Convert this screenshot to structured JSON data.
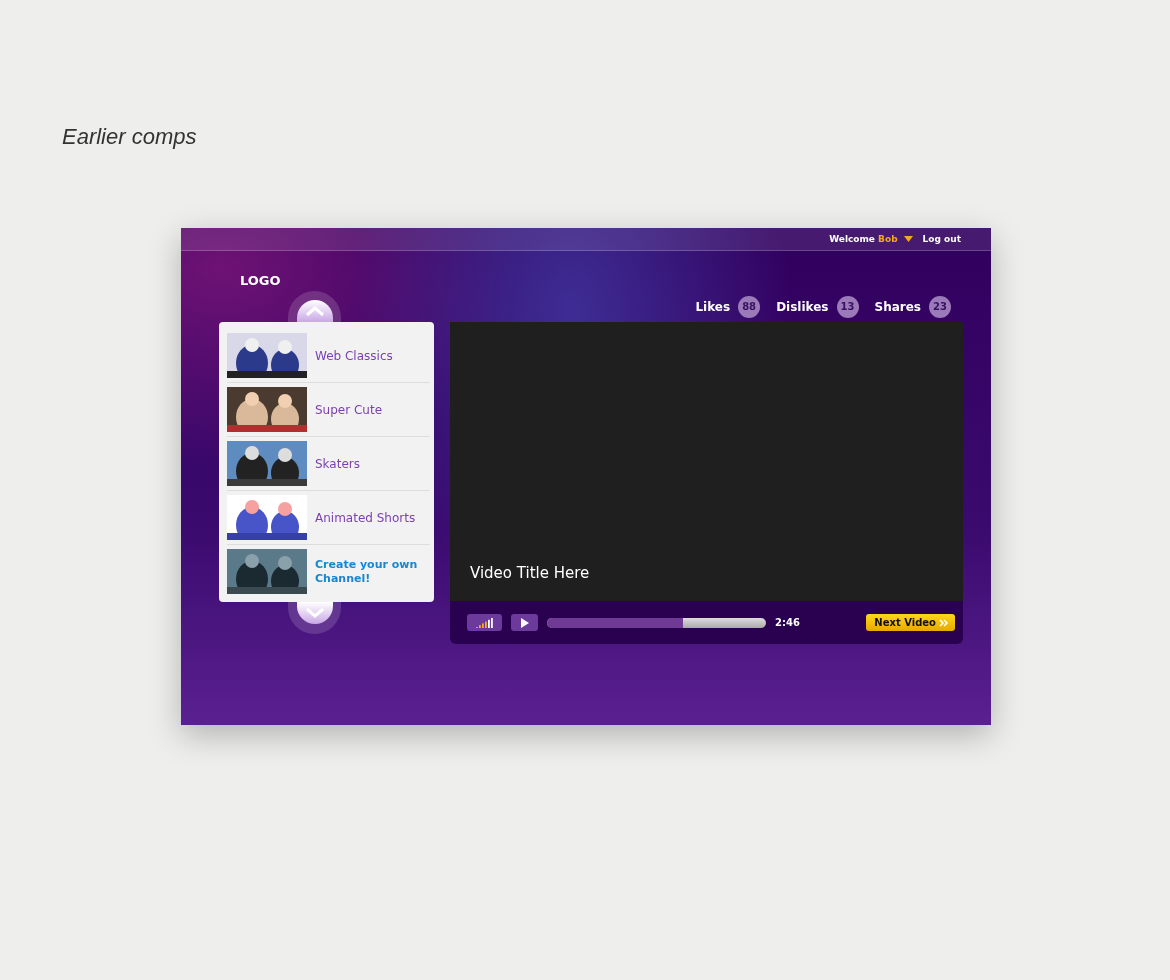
{
  "heading": "Earlier comps",
  "top_bar": {
    "welcome": "Welcome",
    "user": "Bob",
    "logout": "Log out"
  },
  "logo": "LOGO",
  "stats": [
    {
      "label": "Likes",
      "count": "88"
    },
    {
      "label": "Dislikes",
      "count": "13"
    },
    {
      "label": "Shares",
      "count": "23"
    }
  ],
  "channels": [
    {
      "kind": "category",
      "label": "Web Classics"
    },
    {
      "kind": "category",
      "label": "Super Cute"
    },
    {
      "kind": "category",
      "label": "Skaters"
    },
    {
      "kind": "category",
      "label": "Animated Shorts"
    },
    {
      "kind": "create",
      "label": "Create your own Channel!"
    }
  ],
  "video": {
    "title": "Video Title Here",
    "progress": {
      "level": 0.62
    },
    "time": "2:46",
    "next": "Next Video"
  }
}
